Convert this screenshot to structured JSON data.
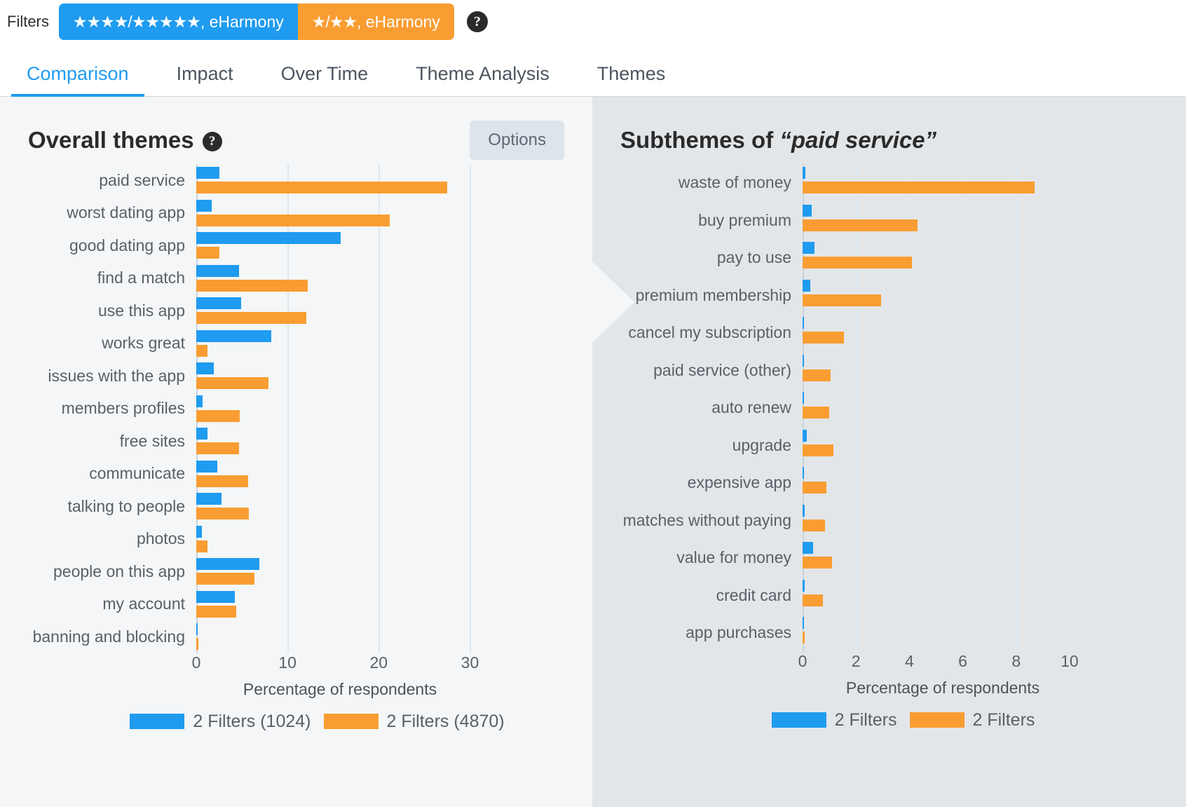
{
  "filters": {
    "label": "Filters",
    "help_icon": "question-mark-icon",
    "chips": [
      {
        "stars": "★★★★/★★★★★",
        "text": ", eHarmony",
        "color": "#1f9bf0"
      },
      {
        "stars": "★/★★",
        "text": ", eHarmony",
        "color": "#f99d32"
      }
    ]
  },
  "tabs": [
    {
      "label": "Comparison",
      "active": true
    },
    {
      "label": "Impact",
      "active": false
    },
    {
      "label": "Over Time",
      "active": false
    },
    {
      "label": "Theme Analysis",
      "active": false
    },
    {
      "label": "Themes",
      "active": false
    }
  ],
  "left_panel": {
    "title": "Overall themes",
    "help_icon": "question-mark-icon",
    "options_button": "Options"
  },
  "right_panel": {
    "title_prefix": "Subthemes of ",
    "title_quoted": "“paid service”"
  },
  "colors": {
    "blue": "#1f9bf0",
    "orange": "#f99d32",
    "left_bg": "#f4f6f7",
    "right_bg": "#e3e6e9",
    "active_tab": "#1f9bf0"
  },
  "chart_data": [
    {
      "id": "overall-themes",
      "type": "bar",
      "orientation": "horizontal",
      "title": "Overall themes",
      "xlabel": "Percentage of respondents",
      "ylabel": "",
      "xlim": [
        0,
        31.5
      ],
      "xticks": [
        0,
        10,
        20,
        30
      ],
      "grid": true,
      "legend_position": "bottom",
      "categories": [
        "paid service",
        "worst dating app",
        "good dating app",
        "find a match",
        "use this app",
        "works great",
        "issues with the app",
        "members profiles",
        "free sites",
        "communicate",
        "talking to people",
        "photos",
        "people on this app",
        "my account",
        "banning and blocking"
      ],
      "series": [
        {
          "name": "2 Filters (1024)",
          "color": "#1f9bf0",
          "values": [
            2.5,
            1.7,
            15.8,
            4.7,
            4.9,
            8.2,
            1.9,
            0.7,
            1.2,
            2.3,
            2.8,
            0.6,
            6.9,
            4.2,
            0.0
          ]
        },
        {
          "name": "2 Filters (4870)",
          "color": "#f99d32",
          "values": [
            27.5,
            21.2,
            2.5,
            12.2,
            12.1,
            1.2,
            7.9,
            4.8,
            4.7,
            5.7,
            5.8,
            1.2,
            6.4,
            4.4,
            0.1
          ]
        }
      ]
    },
    {
      "id": "subthemes-paid-service",
      "type": "bar",
      "orientation": "horizontal",
      "title": "Subthemes of “paid service”",
      "xlabel": "Percentage of respondents",
      "ylabel": "",
      "xlim": [
        0,
        10.5
      ],
      "xticks": [
        0,
        2,
        4,
        6,
        8,
        10
      ],
      "grid": true,
      "legend_position": "bottom",
      "categories": [
        "waste of money",
        "buy premium",
        "pay to use",
        "premium membership",
        "cancel my subscription",
        "paid service (other)",
        "auto renew",
        "upgrade",
        "expensive app",
        "matches without paying",
        "value for money",
        "credit card",
        "app purchases"
      ],
      "series": [
        {
          "name": "2 Filters",
          "color": "#1f9bf0",
          "values": [
            0.1,
            0.35,
            0.45,
            0.3,
            0.0,
            0.0,
            0.0,
            0.15,
            0.0,
            0.08,
            0.4,
            0.08,
            0.0
          ]
        },
        {
          "name": "2 Filters",
          "color": "#f99d32",
          "values": [
            8.7,
            4.3,
            4.1,
            2.95,
            1.55,
            1.05,
            1.0,
            1.15,
            0.9,
            0.85,
            1.1,
            0.75,
            0.05
          ]
        }
      ]
    }
  ]
}
